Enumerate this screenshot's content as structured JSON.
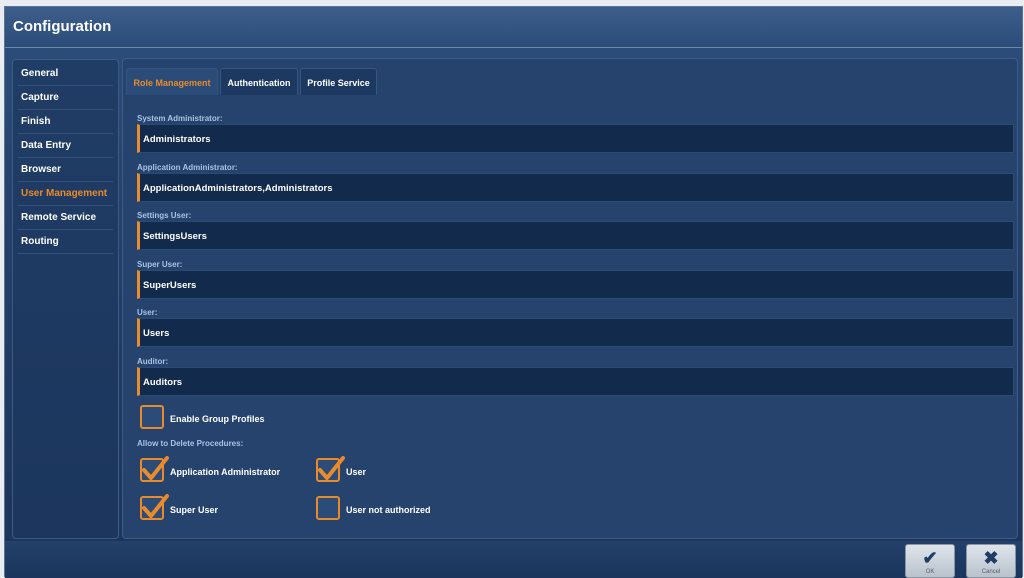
{
  "window": {
    "title": "Configuration"
  },
  "sidebar": {
    "items": [
      {
        "label": "General"
      },
      {
        "label": "Capture"
      },
      {
        "label": "Finish"
      },
      {
        "label": "Data Entry"
      },
      {
        "label": "Browser"
      },
      {
        "label": "User Management",
        "active": true
      },
      {
        "label": "Remote Service"
      },
      {
        "label": "Routing"
      }
    ]
  },
  "tabs": [
    {
      "label": "Role Management",
      "active": true
    },
    {
      "label": "Authentication"
    },
    {
      "label": "Profile Service"
    }
  ],
  "fields": [
    {
      "label": "System Administrator:",
      "value": "Administrators"
    },
    {
      "label": "Application Administrator:",
      "value": "ApplicationAdministrators,Administrators"
    },
    {
      "label": "Settings User:",
      "value": "SettingsUsers"
    },
    {
      "label": "Super User:",
      "value": "SuperUsers"
    },
    {
      "label": "User:",
      "value": "Users"
    },
    {
      "label": "Auditor:",
      "value": "Auditors"
    }
  ],
  "options": {
    "enable_group_profiles": {
      "label": "Enable Group Profiles",
      "checked": false
    },
    "delete_label": "Allow to Delete Procedures:",
    "delete": [
      {
        "label": "Application Administrator",
        "checked": true
      },
      {
        "label": "User",
        "checked": true
      },
      {
        "label": "Super User",
        "checked": true
      },
      {
        "label": "User not authorized",
        "checked": false
      }
    ]
  },
  "footer": {
    "ok_label": "OK",
    "cancel_label": "Cancel"
  },
  "colors": {
    "accent": "#e98b2a",
    "background": "#25436d",
    "field_bg": "#122a4c"
  }
}
